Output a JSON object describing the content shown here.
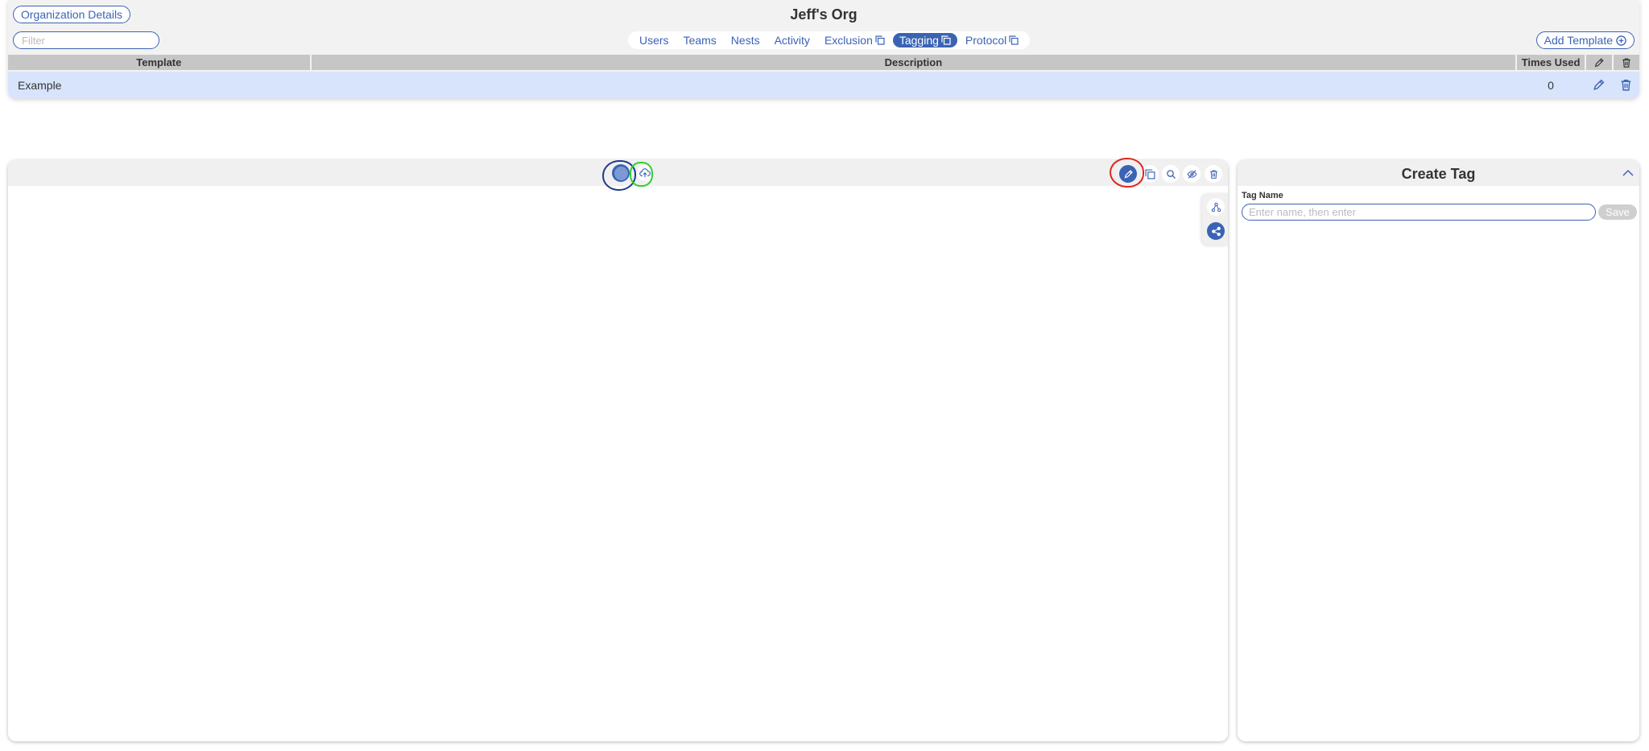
{
  "header": {
    "org_details_label": "Organization Details",
    "org_title": "Jeff's Org",
    "filter_placeholder": "Filter",
    "add_template_label": "Add Template"
  },
  "nav": {
    "tabs": [
      {
        "label": "Users",
        "active": false,
        "copy_icon": false
      },
      {
        "label": "Teams",
        "active": false,
        "copy_icon": false
      },
      {
        "label": "Nests",
        "active": false,
        "copy_icon": false
      },
      {
        "label": "Activity",
        "active": false,
        "copy_icon": false
      },
      {
        "label": "Exclusion",
        "active": false,
        "copy_icon": true
      },
      {
        "label": "Tagging",
        "active": true,
        "copy_icon": true
      },
      {
        "label": "Protocol",
        "active": false,
        "copy_icon": true
      }
    ]
  },
  "table": {
    "columns": {
      "template": "Template",
      "description": "Description",
      "times_used": "Times Used"
    },
    "rows": [
      {
        "template": "Example",
        "description": "",
        "times_used": "0"
      }
    ]
  },
  "tag_panel": {
    "title": "Create Tag",
    "field_label": "Tag Name",
    "input_placeholder": "Enter name, then enter",
    "save_label": "Save"
  },
  "icons": {
    "graph_toolbar": [
      "node-icon",
      "cloud-upload-icon",
      "pencil-icon",
      "copy-icon",
      "search-icon",
      "eye-slash-icon",
      "trash-icon"
    ],
    "side_tools": [
      "hierarchy-icon",
      "network-icon"
    ]
  },
  "colors": {
    "accent": "#3b63b4",
    "row_selected": "#d7e4fb",
    "header_cell": "#c6c6c6",
    "panel_bg": "#f0f0f0"
  }
}
